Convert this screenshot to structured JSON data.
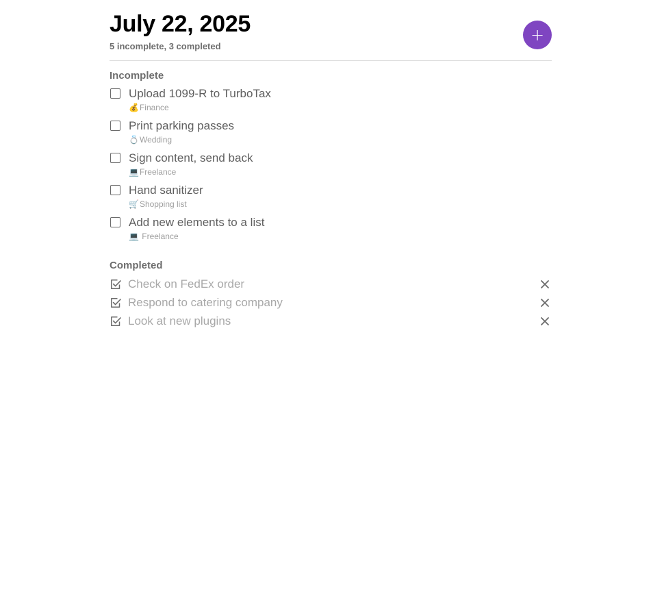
{
  "header": {
    "date": "July 22, 2025",
    "summary": "5 incomplete, 3 completed",
    "add_button_symbol": "+",
    "accent_color": "#7f45c1"
  },
  "incomplete": {
    "title": "Incomplete",
    "tasks": [
      {
        "text": "Upload 1099-R to TurboTax",
        "tag_icon": "💰",
        "tag": "Finance",
        "checked": false
      },
      {
        "text": "Print parking passes",
        "tag_icon": "💍",
        "tag": "Wedding",
        "checked": false
      },
      {
        "text": "Sign content, send back",
        "tag_icon": "💻",
        "tag": "Freelance",
        "checked": false
      },
      {
        "text": "Hand sanitizer",
        "tag_icon": "🛒",
        "tag": "Shopping list",
        "checked": false
      },
      {
        "text": "Add new elements to a list",
        "tag_icon": "💻",
        "tag": " Freelance",
        "checked": false
      }
    ]
  },
  "completed": {
    "title": "Completed",
    "tasks": [
      {
        "text": "Check on FedEx order",
        "checked": true
      },
      {
        "text": "Respond to catering company",
        "checked": true
      },
      {
        "text": "Look at new plugins",
        "checked": true
      }
    ]
  },
  "icons": {
    "checkbox_empty": "checkbox-empty-icon",
    "checkbox_checked": "checkbox-checked-icon",
    "remove": "close-icon",
    "add": "plus-icon"
  }
}
